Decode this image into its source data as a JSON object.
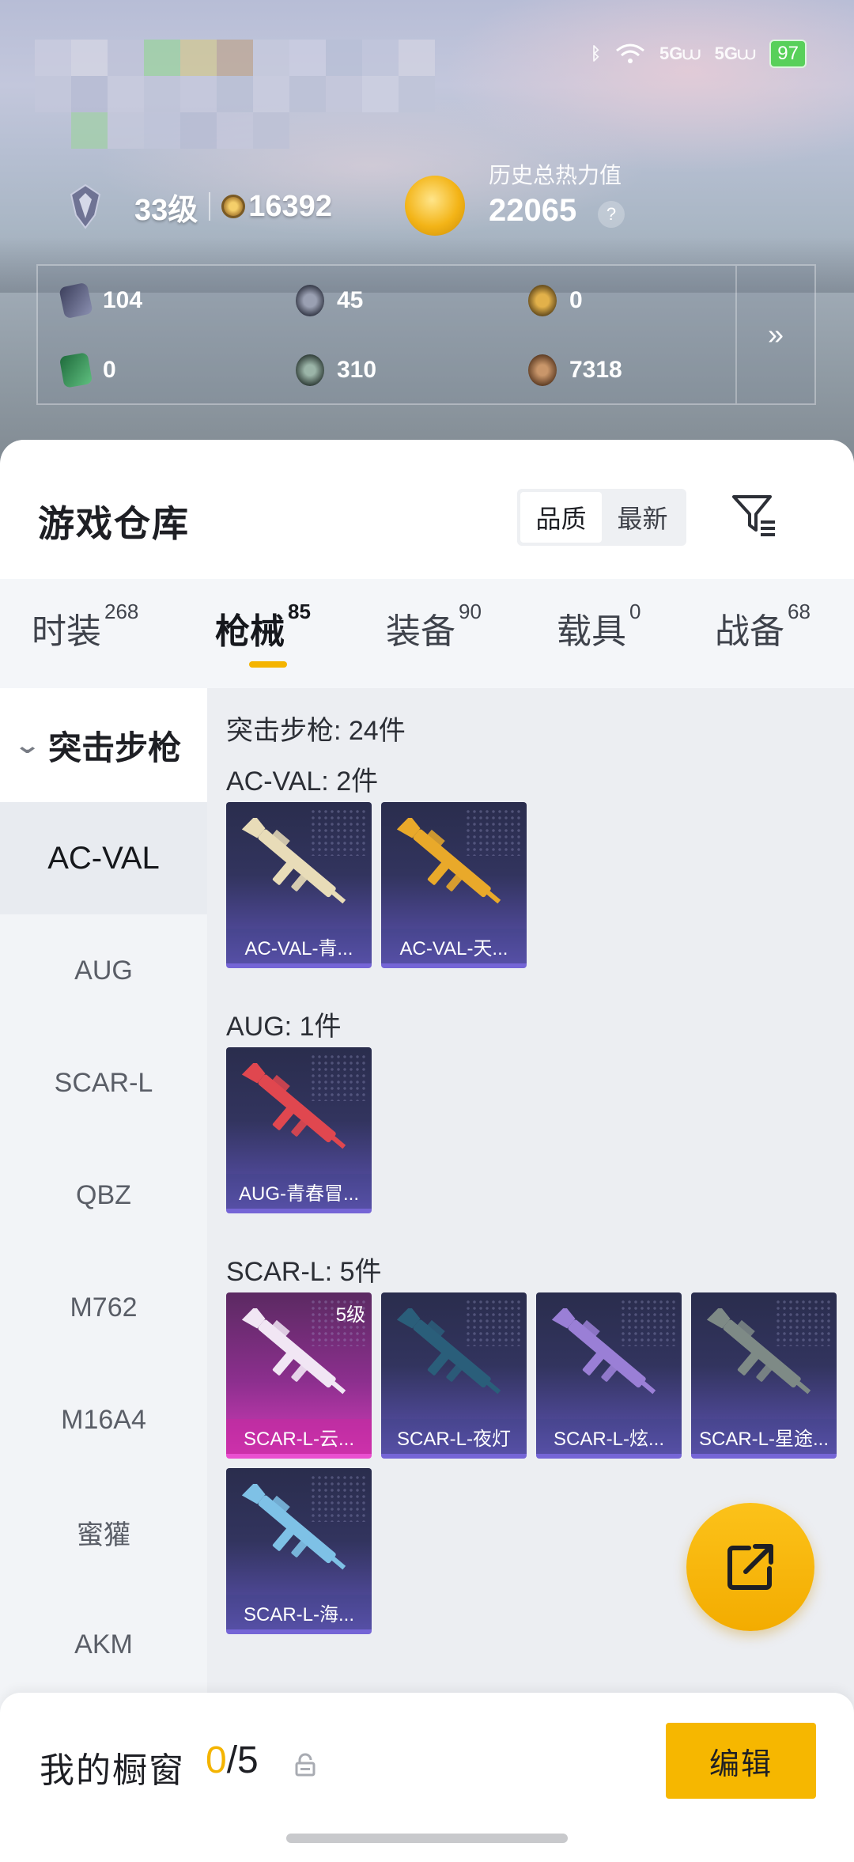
{
  "status_bar": {
    "battery": "97",
    "icons": [
      "bluetooth-icon",
      "wifi-icon",
      "5g-signal-icon",
      "5g-signal-icon"
    ]
  },
  "profile": {
    "level": "33级",
    "coins": "16392",
    "heat_label": "历史总热力值",
    "heat_value": "22065",
    "help": "?"
  },
  "stats": [
    {
      "icon": "card-icon",
      "value": "104"
    },
    {
      "icon": "s-coin-icon",
      "value": "45"
    },
    {
      "icon": "a-coin-icon",
      "value": "0"
    },
    {
      "icon": "ticket-icon",
      "value": "0"
    },
    {
      "icon": "orb-icon",
      "value": "310"
    },
    {
      "icon": "bag-icon",
      "value": "7318"
    }
  ],
  "stats_more": "»",
  "warehouse": {
    "title": "游戏仓库",
    "sort_options": [
      "品质",
      "最新"
    ],
    "active_sort": "品质"
  },
  "tabs": [
    {
      "label": "时装",
      "count": "268"
    },
    {
      "label": "枪械",
      "count": "85"
    },
    {
      "label": "装备",
      "count": "90"
    },
    {
      "label": "载具",
      "count": "0"
    },
    {
      "label": "战备",
      "count": "68"
    }
  ],
  "active_tab": "枪械",
  "sidebar": {
    "group": "突击步枪",
    "items": [
      "AC-VAL",
      "AUG",
      "SCAR-L",
      "QBZ",
      "M762",
      "M16A4",
      "蜜獾",
      "AKM"
    ],
    "active_item": "AC-VAL"
  },
  "content": {
    "header": "突击步枪: 24件",
    "sections": [
      {
        "label": "AC-VAL: 2件",
        "items": [
          {
            "name": "AC-VAL-青...",
            "rarity": "purple",
            "gun_color": "#e8dcb8"
          },
          {
            "name": "AC-VAL-天...",
            "rarity": "purple",
            "gun_color": "#e9a92a"
          }
        ]
      },
      {
        "label": "AUG: 1件",
        "items": [
          {
            "name": "AUG-青春冒...",
            "rarity": "purple",
            "gun_color": "#e0474f"
          }
        ]
      },
      {
        "label": "SCAR-L: 5件",
        "items": [
          {
            "name": "SCAR-L-云...",
            "rarity": "pink",
            "level": "5级",
            "gun_color": "#f1e6f4"
          },
          {
            "name": "SCAR-L-夜灯",
            "rarity": "purple",
            "gun_color": "#2a5e7a"
          },
          {
            "name": "SCAR-L-炫...",
            "rarity": "purple",
            "gun_color": "#9a7fd6"
          },
          {
            "name": "SCAR-L-星途...",
            "rarity": "purple",
            "gun_color": "#7e8a86"
          },
          {
            "name": "SCAR-L-海...",
            "rarity": "purple",
            "gun_color": "#7ec1e6"
          }
        ]
      }
    ]
  },
  "showcase": {
    "label": "我的橱窗",
    "current": "0",
    "total": "/5",
    "edit_label": "编辑"
  },
  "colors": {
    "accent": "#f4b400",
    "purple_card": "#4d4794",
    "pink_card": "#d23bb7"
  }
}
